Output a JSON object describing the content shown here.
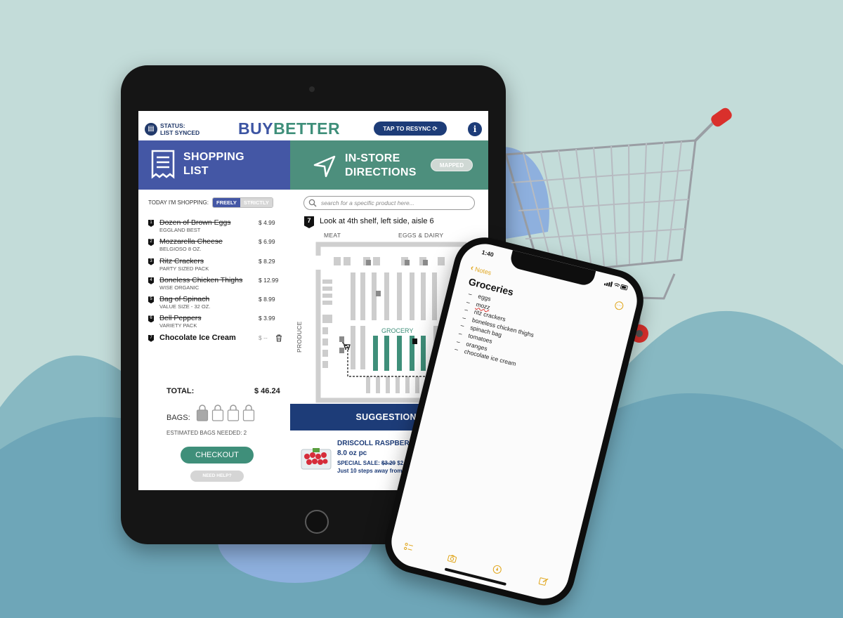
{
  "colors": {
    "brand_blue": "#4457a5",
    "brand_green": "#3f8f7a",
    "navy": "#1d3c78",
    "notes_accent": "#e0a51a"
  },
  "header": {
    "status_label": "STATUS:",
    "status_value": "LIST SYNCED",
    "logo_part1": "BUY",
    "logo_part2": "BETTER",
    "resync_label": "TAP TO RESYNC",
    "info_icon": "info-icon"
  },
  "shopping_list": {
    "title_line1": "SHOPPING",
    "title_line2": "LIST",
    "mode_label": "TODAY I'M SHOPPING:",
    "mode_options": [
      "FREELY",
      "STRICTLY"
    ],
    "mode_selected": "FREELY",
    "items": [
      {
        "num": "1",
        "name": "Dozen of Brown Eggs",
        "sub": "EGGLAND BEST",
        "price": "$ 4.99",
        "checked": true
      },
      {
        "num": "2",
        "name": "Mozzarella Cheese",
        "sub": "BELGIOSO 8 OZ.",
        "price": "$ 6.99",
        "checked": true
      },
      {
        "num": "3",
        "name": "Ritz Crackers",
        "sub": "PARTY SIZED PACK",
        "price": "$ 8.29",
        "checked": true
      },
      {
        "num": "4",
        "name": "Boneless Chicken Thighs",
        "sub": "WISE ORGANIC",
        "price": "$ 12.99",
        "checked": true
      },
      {
        "num": "5",
        "name": "Bag of Spinach",
        "sub": "VALUE SIZE - 32 OZ.",
        "price": "$ 8.99",
        "checked": true
      },
      {
        "num": "6",
        "name": "Bell Peppers",
        "sub": "VARIETY PACK",
        "price": "$ 3.99",
        "checked": true
      },
      {
        "num": "7",
        "name": "Chocolate Ice Cream",
        "sub": "",
        "price": "$ --",
        "checked": false
      }
    ],
    "total_label": "TOTAL:",
    "total_value": "$ 46.24",
    "bags_label": "BAGS:",
    "bags_count": 4,
    "bags_filled": 1,
    "bags_note": "ESTIMATED BAGS NEEDED: 2",
    "checkout_label": "CHECKOUT",
    "help_label": "NEED HELP?"
  },
  "directions": {
    "title_line1": "IN-STORE",
    "title_line2": "DIRECTIONS",
    "badge": "MAPPED",
    "search_placeholder": "search for a specific product here...",
    "step_number": "7",
    "step_text": "Look at 4th shelf, left side, aisle 6",
    "map_labels": {
      "meat": "MEAT",
      "eggs_dairy": "EGGS & DAIRY",
      "produce": "PRODUCE",
      "grocery": "GROCERY"
    }
  },
  "suggestions": {
    "heading": "SUGGESTIONS",
    "product_name": "DRISCOLL RASPBERRIES",
    "product_size": "8.0 oz pc",
    "sale_label": "SPECIAL SALE:",
    "old_price": "$3.29",
    "new_price": "$2.99",
    "distance_text": "Just 10 steps away from you"
  },
  "notes_app": {
    "time": "1:40",
    "back_label": "Notes",
    "title": "Groceries",
    "lines": [
      "eggs",
      "mozz",
      "ritz crackers",
      "boneless chicken thighs",
      "spinach bag",
      "tomatoes",
      "oranges",
      "chocolate ice cream"
    ]
  }
}
